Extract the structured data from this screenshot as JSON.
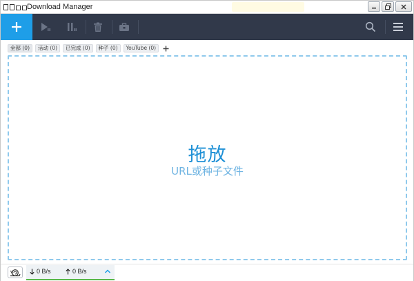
{
  "window": {
    "title": "Download Manager",
    "controls": [
      "minimize",
      "maximize",
      "close"
    ]
  },
  "toolbar": {
    "buttons": [
      {
        "name": "add",
        "icon": "plus-icon"
      },
      {
        "name": "resume",
        "icon": "play-icon"
      },
      {
        "name": "pause",
        "icon": "pause-icon"
      },
      {
        "name": "delete",
        "icon": "trash-icon"
      },
      {
        "name": "move",
        "icon": "briefcase-icon"
      },
      {
        "name": "search",
        "icon": "search-icon"
      },
      {
        "name": "menu",
        "icon": "hamburger-icon"
      }
    ],
    "accent_color": "#1e9ee8",
    "background_color": "#31394a"
  },
  "tags": [
    {
      "label": "全部 (0)",
      "active": true
    },
    {
      "label": "活动 (0)",
      "active": false
    },
    {
      "label": "已完成 (0)",
      "active": false
    },
    {
      "label": "种子 (0)",
      "active": false
    },
    {
      "label": "YouTube (0)",
      "active": false
    }
  ],
  "dropzone": {
    "title": "拖放",
    "subtitle": "URL或种子文件"
  },
  "status": {
    "download_speed": "0 B/s",
    "upload_speed": "0 B/s",
    "speed_indicator_color": "#59b84a"
  }
}
